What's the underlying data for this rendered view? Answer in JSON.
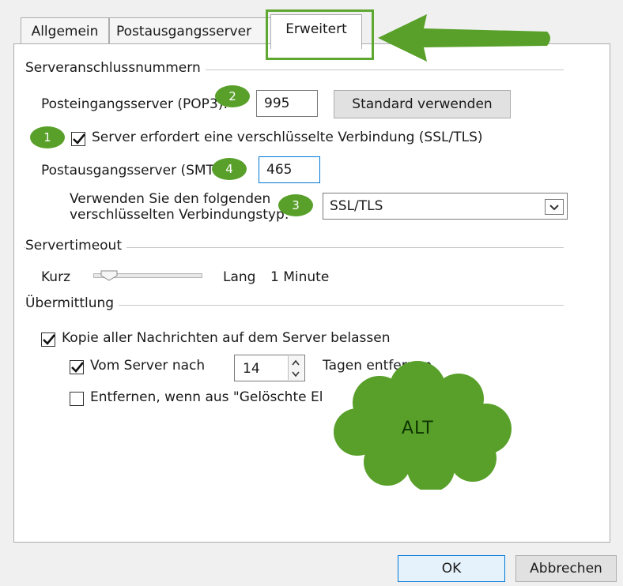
{
  "tabs": [
    {
      "label": "Allgemein"
    },
    {
      "label": "Postausgangsserver"
    },
    {
      "label": "Erweitert"
    }
  ],
  "ports": {
    "group_label": "Serveranschlussnummern",
    "incoming_label": "Posteingangsserver (POP3):",
    "incoming_value": "995",
    "default_button": "Standard verwenden",
    "ssl_checkbox_label": "Server erfordert eine verschlüsselte Verbindung (SSL/TLS)",
    "ssl_checked": true,
    "outgoing_label": "Postausgangsserver (SMTP):",
    "outgoing_value": "465",
    "encryption_label_line1": "Verwenden Sie den folgenden",
    "encryption_label_line2": "verschlüsselten Verbindungstyp:",
    "encryption_value": "SSL/TLS"
  },
  "timeout": {
    "group_label": "Servertimeout",
    "short_label": "Kurz",
    "long_label": "Lang",
    "value_text": "1 Minute"
  },
  "delivery": {
    "group_label": "Übermittlung",
    "keep_copy_label": "Kopie aller Nachrichten auf dem Server belassen",
    "keep_copy_checked": true,
    "remove_after_label": "Vom Server nach",
    "remove_after_checked": true,
    "days_value": "14",
    "days_suffix": "Tagen entfernen",
    "remove_deleted_label": "Entfernen, wenn aus \"Gelöschte El",
    "remove_deleted_checked": false
  },
  "footer": {
    "ok_label": "OK",
    "cancel_label": "Abbrechen"
  },
  "annotations": {
    "badges": [
      "1",
      "2",
      "3",
      "4"
    ],
    "cloud_text": "ALT",
    "accent_color": "#58a02a"
  }
}
